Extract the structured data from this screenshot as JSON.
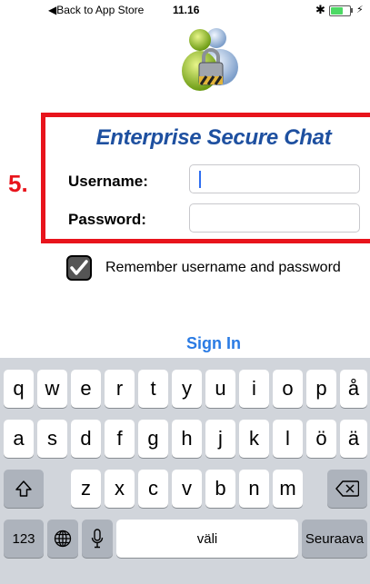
{
  "status_bar": {
    "back_label": "◀Back to App Store",
    "time": "11.16",
    "bluetooth_icon": "bluetooth-icon",
    "battery_icon": "battery-icon"
  },
  "app": {
    "title": "Enterprise Secure Chat",
    "username_label": "Username:",
    "password_label": "Password:",
    "username_value": "",
    "password_value": "",
    "remember_checked": true,
    "remember_label": "Remember username and password",
    "sign_in_label": "Sign In",
    "logo_icon": "users-lock-icon"
  },
  "annotation": {
    "step_label": "5.",
    "color": "#e8141c"
  },
  "keyboard": {
    "row1": [
      "q",
      "w",
      "e",
      "r",
      "t",
      "y",
      "u",
      "i",
      "o",
      "p",
      "å"
    ],
    "row2": [
      "a",
      "s",
      "d",
      "f",
      "g",
      "h",
      "j",
      "k",
      "l",
      "ö",
      "ä"
    ],
    "row3": [
      "z",
      "x",
      "c",
      "v",
      "b",
      "n",
      "m"
    ],
    "numbers_key": "123",
    "space_label": "väli",
    "return_label": "Seuraava",
    "shift_icon": "shift-icon",
    "delete_icon": "delete-icon",
    "globe_icon": "globe-icon",
    "mic_icon": "microphone-icon"
  },
  "colors": {
    "title": "#1e50a0",
    "link": "#2a7be4",
    "caret": "#2f6ef0"
  }
}
